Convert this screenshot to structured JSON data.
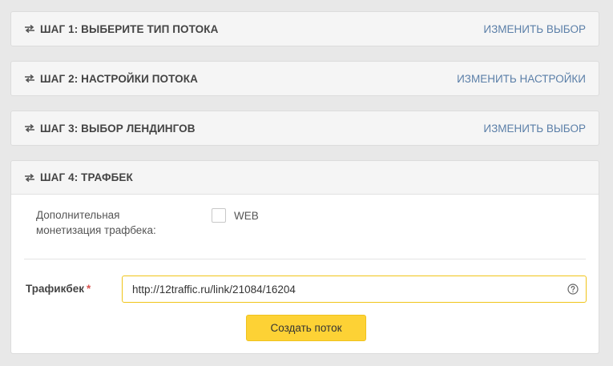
{
  "steps": [
    {
      "title": "ШАГ 1: ВЫБЕРИТЕ ТИП ПОТОКА",
      "action": "ИЗМЕНИТЬ ВЫБОР"
    },
    {
      "title": "ШАГ 2: НАСТРОЙКИ ПОТОКА",
      "action": "ИЗМЕНИТЬ НАСТРОЙКИ"
    },
    {
      "title": "ШАГ 3: ВЫБОР ЛЕНДИНГОВ",
      "action": "ИЗМЕНИТЬ ВЫБОР"
    },
    {
      "title": "ШАГ 4: ТРАФБЕК"
    }
  ],
  "step4": {
    "monetization_label_line1": "Дополнительная",
    "monetization_label_line2": "монетизация трафбека:",
    "web_checkbox_label": "WEB",
    "web_checked": false,
    "trafficback_label": "Трафикбек",
    "required_mark": "*",
    "trafficback_value": "http://12traffic.ru/link/21084/16204",
    "submit_label": "Создать поток"
  },
  "colors": {
    "accent_yellow": "#fdd235",
    "input_focus_border": "#f0c419",
    "link_blue": "#5b7fa8",
    "required_red": "#d9534f"
  },
  "icons": {
    "step_icon": "swap-arrows-icon",
    "help_icon": "question-circle-icon"
  }
}
